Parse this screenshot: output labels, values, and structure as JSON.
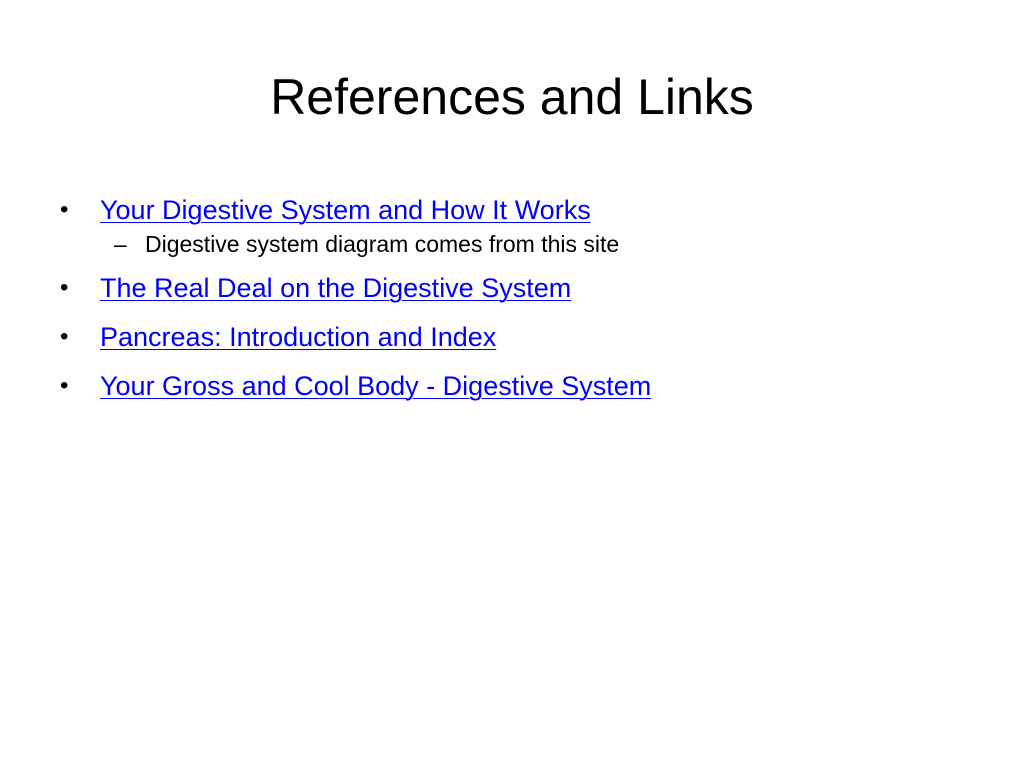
{
  "slide": {
    "title": "References and Links",
    "bullet_glyph": "•",
    "dash_glyph": "–",
    "link_color": "#0000ff",
    "items": [
      {
        "label": "Your Digestive System and How It Works",
        "sub": "Digestive system diagram comes from this site"
      },
      {
        "label": "The Real Deal on the Digestive System"
      },
      {
        "label": "Pancreas: Introduction and Index"
      },
      {
        "label": "Your Gross and Cool Body - Digestive System"
      }
    ]
  }
}
